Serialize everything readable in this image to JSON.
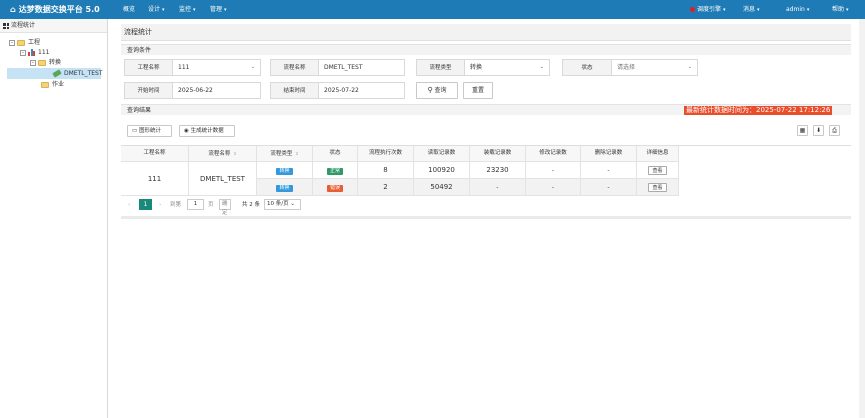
{
  "app": {
    "title": "达梦数据交换平台 5.0"
  },
  "topnav": {
    "overview": "概览",
    "design": "设计",
    "monitor": "监控",
    "manage": "管理",
    "engine": "调度引擎",
    "messages": "消息",
    "user": "admin",
    "help": "帮助"
  },
  "sidebar": {
    "header": "流程统计",
    "tree": {
      "root": "工程",
      "project": "111",
      "group": "转换",
      "selected": "DMETL_TEST",
      "job": "作业"
    }
  },
  "page": {
    "title": "流程统计",
    "query_section": "查询条件",
    "result_section": "查询结果",
    "latest_stat_time": "最新统计数据时间为：2025-07-22 17:12:26"
  },
  "filters": {
    "project_label": "工程名称",
    "project_value": "111",
    "flow_label": "流程名称",
    "flow_value": "DMETL_TEST",
    "type_label": "流程类型",
    "type_value": "转换",
    "status_label": "状态",
    "status_placeholder": "请选择",
    "start_label": "开始时间",
    "start_value": "2025-06-22",
    "end_label": "结束时间",
    "end_value": "2025-07-22",
    "query_button": "查询",
    "reset_button": "重置"
  },
  "toolbar": {
    "chart_button": "图形统计",
    "generate_button": "生成统计数据"
  },
  "table": {
    "columns": [
      "工程名称",
      "流程名称",
      "流程类型",
      "状态",
      "流程执行次数",
      "读取记录数",
      "装载记录数",
      "修改记录数",
      "删除记录数",
      "详细信息"
    ],
    "project": "111",
    "flow": "DMETL_TEST",
    "rows": [
      {
        "type": "转换",
        "status": "正常",
        "status_color": "#2e9a67",
        "runs": "8",
        "read": "100920",
        "load": "23230",
        "modify": "-",
        "delete": "-",
        "detail": "查看"
      },
      {
        "type": "转换",
        "status": "错误",
        "status_color": "#e85d33",
        "runs": "2",
        "read": "50492",
        "load": "-",
        "modify": "-",
        "delete": "-",
        "detail": "查看"
      }
    ],
    "type_tag_color": "#3498db"
  },
  "pager": {
    "prev": "‹",
    "current": "1",
    "next": "›",
    "goto_label": "到第",
    "goto_value": "1",
    "page_unit": "页",
    "confirm": "确定",
    "total": "共 2 条",
    "page_size": "10 条/页"
  }
}
